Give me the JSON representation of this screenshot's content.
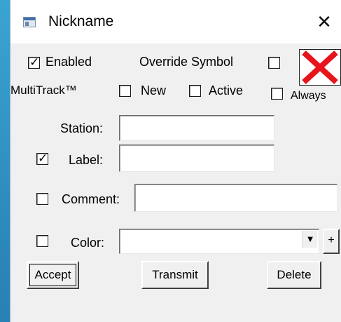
{
  "window": {
    "title": "Nickname",
    "close_glyph": "✕",
    "icon": "app-window-icon"
  },
  "enabled": {
    "label": "Enabled",
    "checked": true
  },
  "override_symbol": {
    "label": "Override Symbol",
    "checked": false,
    "symbol_icon": "red-x-icon"
  },
  "multitrack": {
    "label": "MultiTrack™",
    "new": {
      "label": "New",
      "checked": false
    },
    "active": {
      "label": "Active",
      "checked": false
    },
    "always": {
      "label": "Always",
      "checked": false
    }
  },
  "station": {
    "label": "Station:",
    "value": ""
  },
  "label_field": {
    "label": "Label:",
    "value": "",
    "checked": true
  },
  "comment": {
    "label": "Comment:",
    "value": "",
    "checked": false
  },
  "color": {
    "label": "Color:",
    "value": "",
    "checked": false,
    "plus": "+",
    "arrow": "▼"
  },
  "buttons": {
    "accept": "Accept",
    "transmit": "Transmit",
    "delete": "Delete"
  },
  "colors": {
    "desktop": "#2a85b8",
    "dialog": "#f0f0f0",
    "symbol_x": "#e8141b"
  }
}
